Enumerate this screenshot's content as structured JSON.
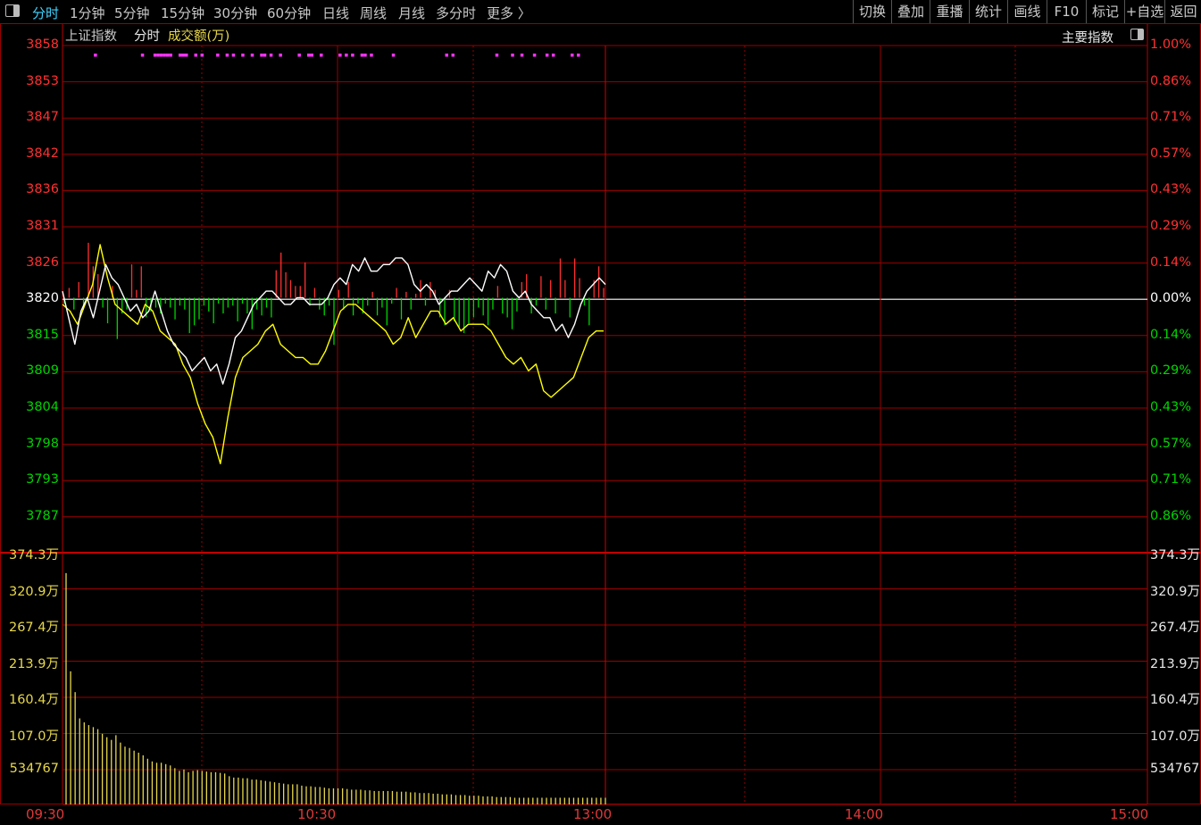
{
  "toolbar": {
    "periods": [
      "分时",
      "1分钟",
      "5分钟",
      "15分钟",
      "30分钟",
      "60分钟",
      "日线",
      "周线",
      "月线",
      "多分时",
      "更多 〉"
    ],
    "tools": [
      "切换",
      "叠加",
      "重播",
      "统计",
      "画线",
      "F10",
      "标记",
      "+自选",
      "返回"
    ]
  },
  "header": {
    "index_name": "上证指数",
    "mode": "分时",
    "indicator": "成交额(万)",
    "main_index_label": "主要指数"
  },
  "price_axis": {
    "left_labels": [
      "3858",
      "3853",
      "3847",
      "3842",
      "3836",
      "3831",
      "3826",
      "3820",
      "3815",
      "3809",
      "3804",
      "3798",
      "3793",
      "3787"
    ],
    "right_labels": [
      "1.00%",
      "0.86%",
      "0.71%",
      "0.57%",
      "0.43%",
      "0.29%",
      "0.14%",
      "0.00%",
      "0.14%",
      "0.29%",
      "0.43%",
      "0.57%",
      "0.71%",
      "0.86%"
    ]
  },
  "volume_axis": {
    "labels": [
      "374.3万",
      "320.9万",
      "267.4万",
      "213.9万",
      "160.4万",
      "107.0万",
      "534767"
    ]
  },
  "time_axis": [
    "09:30",
    "10:30",
    "13:00",
    "14:00",
    "15:00"
  ],
  "colors": {
    "up": "#ff3030",
    "down": "#00d400",
    "flat": "#ffffff",
    "grid": "#9a0000",
    "price_line": "#ffffff",
    "avg_line": "#ffff00",
    "vol": "#e8d84a",
    "markers": "#ff33ff"
  },
  "chart_data": {
    "type": "line",
    "x_range": [
      "09:30",
      "15:00"
    ],
    "y_range": [
      3787,
      3858
    ],
    "base_price": 3820,
    "series": [
      {
        "key": "price",
        "values": [
          3821,
          3817,
          3813,
          3818,
          3820,
          3817,
          3821,
          3825,
          3823,
          3822,
          3820,
          3818,
          3819,
          3817,
          3818,
          3821,
          3818,
          3815,
          3813,
          3812,
          3811,
          3809,
          3810,
          3811,
          3809,
          3810,
          3807,
          3810,
          3814,
          3815,
          3817,
          3819,
          3820,
          3821,
          3821,
          3820,
          3819,
          3819,
          3820,
          3820,
          3819,
          3819,
          3819,
          3820,
          3822,
          3823,
          3822,
          3825,
          3824,
          3826,
          3824,
          3824,
          3825,
          3825,
          3826,
          3826,
          3825,
          3822,
          3821,
          3822,
          3821,
          3819,
          3820,
          3821,
          3821,
          3822,
          3823,
          3822,
          3821,
          3824,
          3823,
          3825,
          3824,
          3821,
          3820,
          3821,
          3819,
          3818,
          3817,
          3817,
          3815,
          3816,
          3814,
          3816,
          3819,
          3821,
          3822,
          3823,
          3822
        ]
      },
      {
        "key": "avg",
        "values": [
          3819,
          3818,
          3816,
          3819,
          3822,
          3828,
          3823,
          3819,
          3818,
          3817,
          3816,
          3819,
          3818,
          3815,
          3814,
          3813,
          3810,
          3808,
          3804,
          3801,
          3799,
          3795,
          3802,
          3808,
          3811,
          3812,
          3813,
          3815,
          3816,
          3813,
          3812,
          3811,
          3811,
          3810,
          3810,
          3812,
          3815,
          3818,
          3819,
          3819,
          3818,
          3817,
          3816,
          3815,
          3813,
          3814,
          3817,
          3814,
          3816,
          3818,
          3818,
          3816,
          3817,
          3815,
          3816,
          3816,
          3816,
          3815,
          3813,
          3811,
          3810,
          3811,
          3809,
          3810,
          3806,
          3805,
          3806,
          3807,
          3808,
          3811,
          3814,
          3815,
          3815
        ]
      },
      {
        "key": "volume",
        "values": [
          3.44,
          1.98,
          1.67,
          1.28,
          1.22,
          1.18,
          1.15,
          1.12,
          1.05,
          1.0,
          0.96,
          1.03,
          0.92,
          0.86,
          0.84,
          0.8,
          0.77,
          0.73,
          0.68,
          0.64,
          0.62,
          0.62,
          0.6,
          0.58,
          0.54,
          0.5,
          0.52,
          0.48,
          0.5,
          0.51,
          0.5,
          0.49,
          0.48,
          0.48,
          0.47,
          0.46,
          0.42,
          0.4,
          0.4,
          0.39,
          0.39,
          0.37,
          0.37,
          0.36,
          0.35,
          0.34,
          0.33,
          0.32,
          0.31,
          0.3,
          0.3,
          0.3,
          0.28,
          0.27,
          0.27,
          0.26,
          0.26,
          0.25,
          0.24,
          0.24,
          0.24,
          0.24,
          0.23,
          0.22,
          0.22,
          0.22,
          0.21,
          0.21,
          0.2,
          0.2,
          0.2,
          0.2,
          0.2,
          0.19,
          0.19,
          0.19,
          0.18,
          0.18,
          0.17,
          0.17,
          0.17,
          0.16,
          0.16,
          0.15,
          0.15,
          0.15,
          0.14,
          0.14,
          0.14,
          0.13,
          0.13,
          0.13,
          0.12,
          0.12,
          0.12,
          0.11,
          0.11,
          0.11,
          0.11,
          0.1,
          0.1,
          0.1,
          0.1,
          0.1,
          0.1,
          0.1,
          0.1,
          0.1,
          0.1,
          0.1,
          0.1,
          0.1,
          0.1,
          0.1,
          0.1,
          0.1,
          0.1,
          0.1,
          0.1,
          0.1
        ]
      },
      {
        "key": "flow",
        "values": [
          -0.3,
          0.5,
          -0.6,
          0.8,
          -0.4,
          2.8,
          1.6,
          1.2,
          -0.5,
          -1.3,
          0.6,
          -2.1,
          -0.8,
          -0.6,
          1.7,
          0.4,
          1.6,
          -1.0,
          -0.7,
          -0.5,
          -0.8,
          -0.3,
          -0.5,
          -1.1,
          -0.4,
          -0.6,
          -1.8,
          -1.4,
          -1.1,
          -0.4,
          -0.7,
          -1.3,
          -0.3,
          -0.8,
          -0.5,
          -0.4,
          -1.2,
          -0.3,
          -0.8,
          -1.6,
          -0.6,
          -0.9,
          -0.5,
          -1.0,
          1.4,
          2.3,
          1.3,
          0.9,
          0.6,
          0.6,
          1.8,
          -0.4,
          0.5,
          -0.6,
          -0.9,
          -0.4,
          -2.4,
          0.4,
          -0.6,
          0.8,
          -0.9,
          -0.3,
          -0.8,
          -0.4,
          0.3,
          -0.9,
          -0.5,
          -1.4,
          -0.3,
          0.5,
          -1.1,
          0.3,
          -0.6,
          0.2,
          0.9,
          -0.4,
          0.8,
          0.4,
          -1.0,
          -1.4,
          0.4,
          -1.2,
          -1.5,
          -1.8,
          -1.3,
          -1.0,
          -0.5,
          -0.9,
          -1.4,
          -0.6,
          0.6,
          -0.8,
          -1.0,
          -1.6,
          -0.7,
          0.8,
          1.2,
          -0.8,
          -0.4,
          1.1,
          -0.6,
          0.9,
          -0.8,
          2.0,
          0.9,
          -1.0,
          2.0,
          1.0,
          -0.4,
          -1.4,
          0.9,
          1.6,
          0.5
        ]
      },
      {
        "key": "markers",
        "values": [
          0.1,
          0.25,
          0.29,
          0.3,
          0.31,
          0.32,
          0.33,
          0.34,
          0.37,
          0.38,
          0.39,
          0.42,
          0.44,
          0.49,
          0.52,
          0.54,
          0.57,
          0.6,
          0.63,
          0.64,
          0.66,
          0.69,
          0.75,
          0.78,
          0.79,
          0.82,
          0.88,
          0.9,
          0.92,
          0.95,
          0.96,
          0.98,
          1.05,
          1.22,
          1.24,
          1.38,
          1.43,
          1.46,
          1.5,
          1.54,
          1.56,
          1.62,
          1.64,
          1.8,
          1.99
        ]
      }
    ]
  }
}
